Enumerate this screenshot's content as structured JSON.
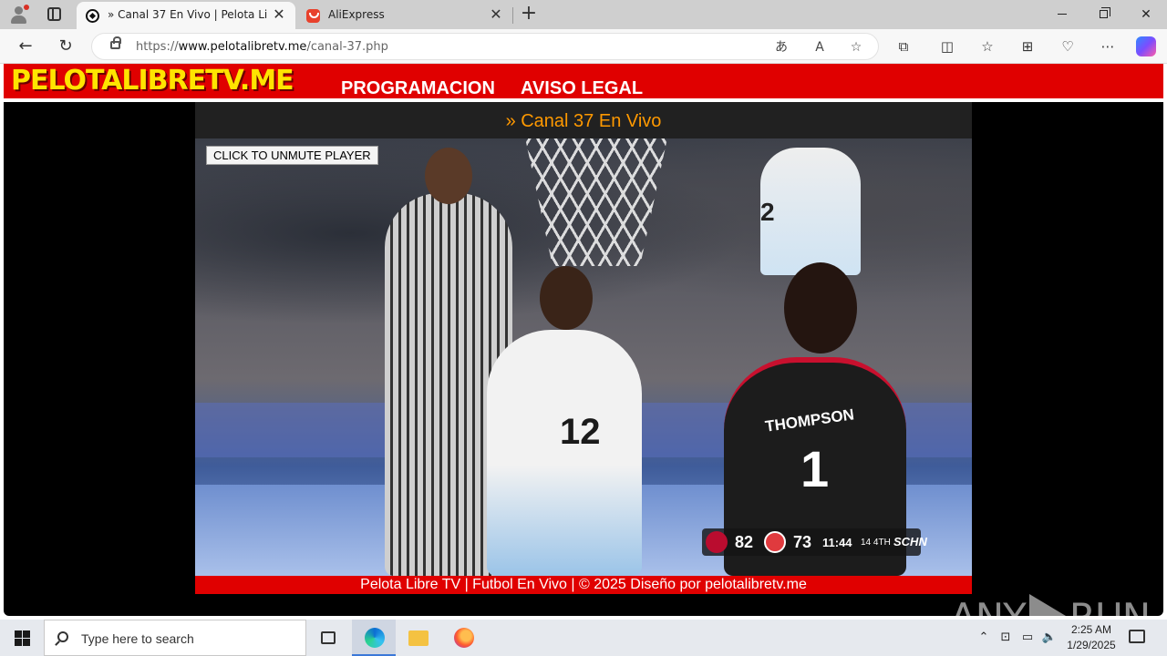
{
  "browser": {
    "tabs": [
      {
        "title": "» Canal 37 En Vivo | Pelota Libre TV",
        "active": true,
        "favicon": "soccer-ball-icon"
      },
      {
        "title": "AliExpress",
        "active": false,
        "favicon": "aliexpress-icon"
      }
    ],
    "close_glyph": "✕",
    "new_tab_glyph": "+",
    "url_prefix": "https://",
    "url_domain": "www.pelotalibretv.me",
    "url_path": "/canal-37.php"
  },
  "site": {
    "logo": "PELOTALIBRETV.ME",
    "nav": [
      "PROGRAMACION",
      "AVISO LEGAL"
    ],
    "player_title": "» Canal 37 En Vivo",
    "unmute_label": "CLICK TO UNMUTE PLAYER",
    "footer": "Pelota Libre TV | Futbol En Vivo | © 2025 Diseño por pelotalibretv.me",
    "colors": {
      "header": "#e00000",
      "logo": "#ffe400",
      "title": "#ff9900"
    }
  },
  "video": {
    "scorebug": {
      "home_score": "82",
      "away_score": "73",
      "clock": "11:44",
      "shot_quarter": "14 4TH",
      "network": "SCHN"
    },
    "jersey_name": "THOMPSON",
    "jersey_numbers": [
      "12",
      "1",
      "2"
    ]
  },
  "watermark": {
    "left": "ANY",
    "right": "RUN"
  },
  "taskbar": {
    "search_placeholder": "Type here to search",
    "time": "2:25 AM",
    "date": "1/29/2025"
  }
}
